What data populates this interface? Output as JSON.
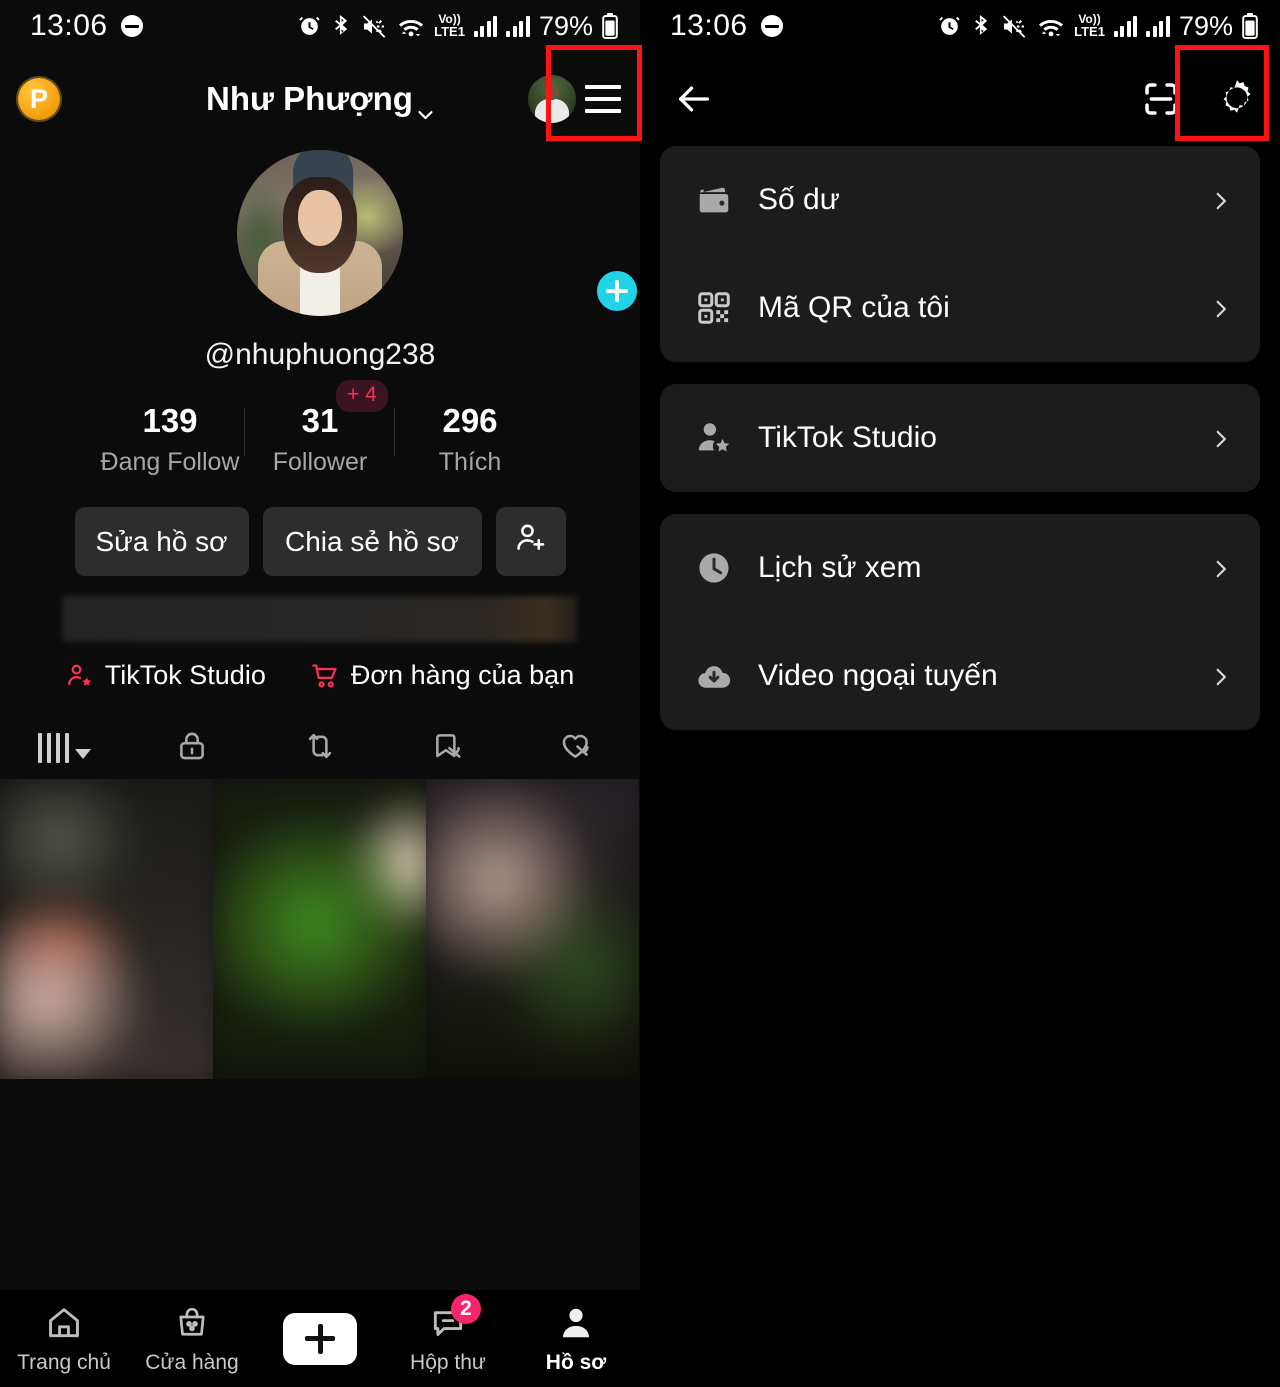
{
  "statusbar": {
    "time": "13:06",
    "battery": "79%",
    "icons": [
      "alarm-icon",
      "bluetooth-icon",
      "mute-icon",
      "wifi-icon",
      "volte-icon",
      "signal-bars-1",
      "signal-bars-2",
      "battery-icon"
    ],
    "volte_top": "Vo))",
    "volte_bottom": "LTE1"
  },
  "left": {
    "header": {
      "coin_label": "P",
      "title": "Như Phượng",
      "chevron": "chevron-down-icon",
      "avatar": "mini-avatar",
      "menu": "hamburger-menu-icon"
    },
    "profile": {
      "handle": "@nhuphuong238",
      "add_story": "add-story-plus-icon",
      "stats": [
        {
          "num": "139",
          "label": "Đang Follow"
        },
        {
          "num": "31",
          "label": "Follower",
          "bump": "+ 4"
        },
        {
          "num": "296",
          "label": "Thích"
        }
      ],
      "buttons": {
        "edit": "Sửa hồ sơ",
        "share": "Chia sẻ hồ sơ",
        "add_user": "add-user-icon"
      },
      "quicklinks": [
        {
          "label": "TikTok Studio",
          "icon": "user-star-icon"
        },
        {
          "label": "Đơn hàng của bạn",
          "icon": "shopping-cart-icon"
        }
      ],
      "tabs": [
        {
          "name": "grid-tab",
          "icon": "grid-bars-icon"
        },
        {
          "name": "private-tab",
          "icon": "lock-icon"
        },
        {
          "name": "reposts-tab",
          "icon": "repost-icon"
        },
        {
          "name": "saved-tab",
          "icon": "bookmark-off-icon"
        },
        {
          "name": "liked-tab",
          "icon": "heart-off-icon"
        }
      ]
    },
    "bottomnav": [
      {
        "label": "Trang chủ",
        "icon": "home-icon",
        "active": false
      },
      {
        "label": "Cửa hàng",
        "icon": "shop-bag-icon",
        "active": false
      },
      {
        "label": "",
        "icon": "create-plus-icon",
        "active": false
      },
      {
        "label": "Hộp thư",
        "icon": "inbox-message-icon",
        "badge": "2",
        "active": false
      },
      {
        "label": "Hồ sơ",
        "icon": "person-icon",
        "active": true
      }
    ]
  },
  "right": {
    "header": {
      "back": "back-arrow-icon",
      "scan": "scan-qr-icon",
      "settings": "gear-icon"
    },
    "groups": [
      {
        "items": [
          {
            "label": "Số dư",
            "icon": "wallet-icon"
          },
          {
            "label": "Mã QR của tôi",
            "icon": "qr-code-icon"
          }
        ]
      },
      {
        "items": [
          {
            "label": "TikTok Studio",
            "icon": "user-star-icon"
          }
        ]
      },
      {
        "items": [
          {
            "label": "Lịch sử xem",
            "icon": "clock-icon"
          },
          {
            "label": "Video ngoại tuyến",
            "icon": "cloud-download-icon"
          }
        ]
      }
    ]
  },
  "annotations": {
    "highlight_color": "#ff1212",
    "boxes": [
      "hamburger-menu-highlight",
      "settings-gear-highlight"
    ]
  },
  "colors": {
    "accent_pink": "#ff2e55",
    "accent_cyan": "#22d3e8",
    "badge_pink": "#f8246c",
    "coin_gold": "#f7a616",
    "card_bg": "#1c1c1c",
    "page_bg": "#000000"
  }
}
